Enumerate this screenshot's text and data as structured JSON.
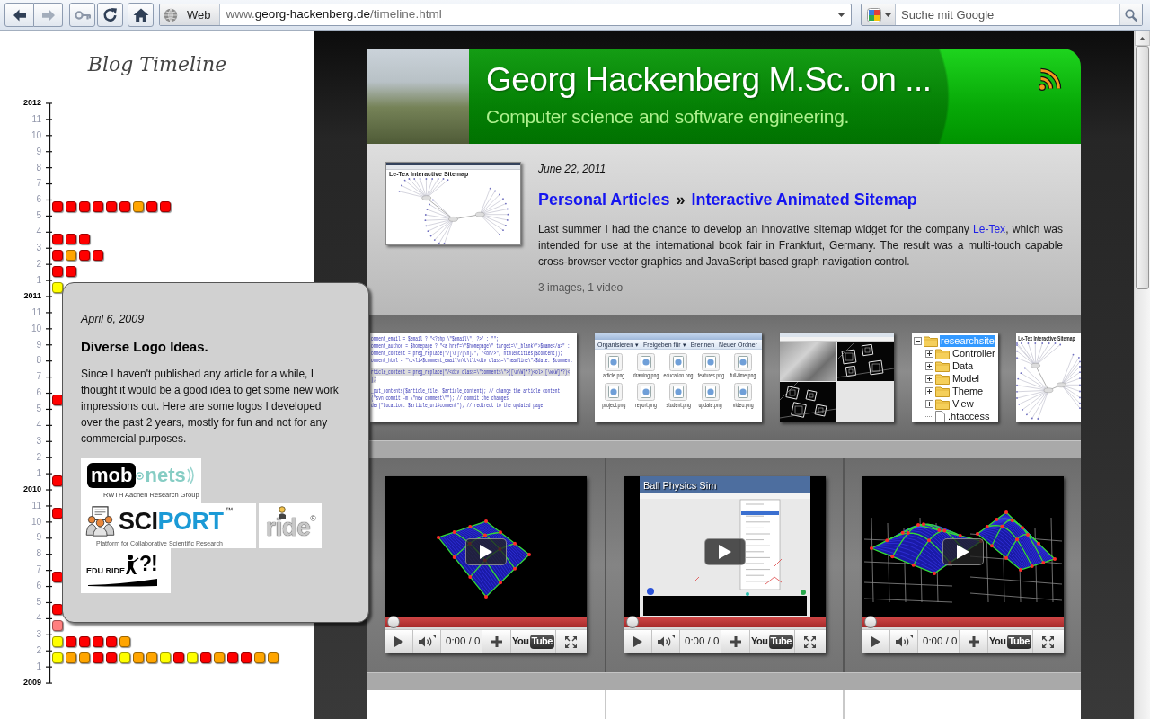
{
  "browser": {
    "back": {
      "disabled": false
    },
    "forward": {
      "disabled": true
    },
    "identity": "Web",
    "url": {
      "prefix": "www.",
      "domain": "georg-hackenberg.de",
      "path": "/timeline.html"
    },
    "search": {
      "placeholder": "Suche mit Google"
    }
  },
  "timeline": {
    "title": "Blog Timeline",
    "ticks": [
      {
        "label": "2012",
        "kind": "year"
      },
      {
        "label": "11",
        "kind": "month"
      },
      {
        "label": "10",
        "kind": "month"
      },
      {
        "label": "9",
        "kind": "month"
      },
      {
        "label": "8",
        "kind": "month"
      },
      {
        "label": "7",
        "kind": "month"
      },
      {
        "label": "6",
        "kind": "month",
        "posts": [
          {
            "color": "#ff0000"
          },
          {
            "color": "#ff0000"
          },
          {
            "color": "#ff0000"
          },
          {
            "color": "#ff0000"
          },
          {
            "color": "#ff0000"
          },
          {
            "color": "#ff0000"
          },
          {
            "color": "#ffa500"
          },
          {
            "color": "#ff0000"
          },
          {
            "color": "#ff0000"
          }
        ]
      },
      {
        "label": "5",
        "kind": "month"
      },
      {
        "label": "4",
        "kind": "month",
        "posts": [
          {
            "color": "#ff0000"
          },
          {
            "color": "#ff0000"
          },
          {
            "color": "#ff0000"
          }
        ]
      },
      {
        "label": "3",
        "kind": "month",
        "posts": [
          {
            "color": "#ff0000"
          },
          {
            "color": "#ffa500"
          },
          {
            "color": "#ff0000"
          },
          {
            "color": "#ff0000"
          }
        ]
      },
      {
        "label": "2",
        "kind": "month",
        "posts": [
          {
            "color": "#ff0000"
          },
          {
            "color": "#ff0000"
          }
        ]
      },
      {
        "label": "1",
        "kind": "month",
        "posts": [
          {
            "color": "#ffff00"
          }
        ]
      },
      {
        "label": "2011",
        "kind": "year"
      },
      {
        "label": "11",
        "kind": "month"
      },
      {
        "label": "10",
        "kind": "month"
      },
      {
        "label": "9",
        "kind": "month"
      },
      {
        "label": "8",
        "kind": "month"
      },
      {
        "label": "7",
        "kind": "month"
      },
      {
        "label": "6",
        "kind": "month",
        "posts": [
          {
            "color": "#ff0000"
          }
        ]
      },
      {
        "label": "5",
        "kind": "month"
      },
      {
        "label": "4",
        "kind": "month"
      },
      {
        "label": "3",
        "kind": "month"
      },
      {
        "label": "2",
        "kind": "month"
      },
      {
        "label": "1",
        "kind": "month",
        "posts": [
          {
            "color": "#ff0000"
          }
        ]
      },
      {
        "label": "2010",
        "kind": "year"
      },
      {
        "label": "11",
        "kind": "month",
        "posts": [
          {
            "color": "#ff0000"
          }
        ]
      },
      {
        "label": "10",
        "kind": "month"
      },
      {
        "label": "9",
        "kind": "month"
      },
      {
        "label": "8",
        "kind": "month"
      },
      {
        "label": "7",
        "kind": "month",
        "posts": [
          {
            "color": "#ff0000"
          }
        ]
      },
      {
        "label": "6",
        "kind": "month"
      },
      {
        "label": "5",
        "kind": "month",
        "posts": [
          {
            "color": "#ff0000"
          }
        ]
      },
      {
        "label": "4",
        "kind": "month",
        "posts": [
          {
            "color": "#ff8080"
          }
        ]
      },
      {
        "label": "3",
        "kind": "month",
        "posts": [
          {
            "color": "#ffff00"
          },
          {
            "color": "#ff0000"
          },
          {
            "color": "#ff0000"
          },
          {
            "color": "#ff0000"
          },
          {
            "color": "#ff0000"
          },
          {
            "color": "#ffa500"
          }
        ]
      },
      {
        "label": "2",
        "kind": "month",
        "posts": [
          {
            "color": "#ffff00"
          },
          {
            "color": "#ffa500"
          },
          {
            "color": "#ffa500"
          },
          {
            "color": "#ff0000"
          },
          {
            "color": "#ff0000"
          },
          {
            "color": "#ffff00"
          },
          {
            "color": "#ffa500"
          },
          {
            "color": "#ffa500"
          },
          {
            "color": "#ffff00"
          },
          {
            "color": "#ff0000"
          },
          {
            "color": "#ffff00"
          },
          {
            "color": "#ff0000"
          },
          {
            "color": "#ffa500"
          },
          {
            "color": "#ff0000"
          },
          {
            "color": "#ff0000"
          },
          {
            "color": "#ffa500"
          },
          {
            "color": "#ffa500"
          }
        ]
      },
      {
        "label": "1",
        "kind": "month"
      },
      {
        "label": "2009",
        "kind": "year"
      }
    ]
  },
  "popup": {
    "date": "April 6, 2009",
    "title": "Diverse Logo Ideas.",
    "text": "Since I haven't published any article for a while, I thought it would be a good idea to get some new work impressions out. Here are some logos I developed over the past 2 years, mostly for fun and not for any commercial purposes.",
    "logos": [
      {
        "kind": "mobonets",
        "words": [
          "mob",
          "nets"
        ],
        "tagline": "RWTH Aachen Research Group"
      },
      {
        "kind": "sciport",
        "words": [
          "SCI",
          "PORT"
        ],
        "mark": "™",
        "tagline": "Platform for Collaborative Scientific Research"
      },
      {
        "kind": "ride",
        "words": [
          "ride"
        ],
        "mark": "®"
      },
      {
        "kind": "eduride",
        "words": [
          "EDU RIDE",
          "?!"
        ]
      }
    ]
  },
  "header": {
    "title": "Georg Hackenberg M.Sc. on ...",
    "subtitle": "Computer science and software engineering."
  },
  "article": {
    "thumbnail_caption": "Le-Tex Interactive Sitemap",
    "date": "June 22, 2011",
    "category": "Personal Articles",
    "separator": "»",
    "title": "Interactive Animated Sitemap",
    "summary": {
      "before": "Last summer I had the chance to develop an innovative sitemap widget for the company ",
      "link": "Le-Tex",
      "after": ", which was intended for use at the international book fair in Frankfurt, Germany. The result was a multi-touch capable cross-browser vector graphics and JavaScript based graph navigation control."
    },
    "media_count": "3 images, 1 video"
  },
  "gallery": [
    {
      "kind": "code",
      "blocks": [
        {
          "lines": [
            {
              "text": "omment_email = $email ? \"<?php \\\"$email\\\"; ?>\" : \"\";",
              "highlighted": false
            },
            {
              "text": "omment_author = $homepage ? \"<a href=\\\"$homepage\\\" target=\\\"_blank\\\">$name</a>\" :",
              "highlighted": false
            },
            {
              "text": "omment_content = preg_replace(\"/[\\r]?[\\n]/\", \"<br/>\", htmlentities($content));",
              "highlighted": false
            },
            {
              "text": "omment_html = \"\\t<li>$comment_email\\n\\t\\t\\t<div class=\\\"headline\\\">$date: $comment",
              "highlighted": false
            }
          ]
        },
        {
          "lines": [
            {
              "text": "rticle_content = preg_replace(\"/<div class=\\\"comments\\\">([\\w\\W]*?)<ol>([\\w\\W]*?)<",
              "highlighted": true
            },
            {
              "text": ");",
              "highlighted": true
            }
          ]
        },
        {
          "lines": [
            {
              "text": "_put_contents($article_file, $article_content); // change the article content",
              "highlighted": false
            },
            {
              "text": "(\"svn commit -m \\\"new comment\\\"\"); // commit the changes",
              "highlighted": false
            },
            {
              "text": "der(\"Location: $article_uri#comment\"); // redirect to the updated page",
              "highlighted": false
            }
          ]
        }
      ]
    },
    {
      "kind": "explorer",
      "toolbar": [
        "Organisieren ▾",
        "Freigeben für ▾",
        "Brennen",
        "Neuer Ordner"
      ],
      "files": [
        "article.png",
        "drawing.png",
        "education.png",
        "features.png",
        "full-time.png",
        "project.png",
        "report.png",
        "student.png",
        "update.png",
        "video.png"
      ]
    },
    {
      "kind": "camera"
    },
    {
      "kind": "tree",
      "items": [
        {
          "label": "researchsite",
          "kind": "folder",
          "expanded": true,
          "selected": true,
          "children": [
            {
              "label": "Controller",
              "kind": "folder",
              "expanded": false,
              "selected": false
            },
            {
              "label": "Data",
              "kind": "folder",
              "expanded": false,
              "selected": false
            },
            {
              "label": "Model",
              "kind": "folder",
              "expanded": false,
              "selected": false
            },
            {
              "label": "Theme",
              "kind": "folder",
              "expanded": false,
              "selected": false
            },
            {
              "label": "View",
              "kind": "folder",
              "expanded": false,
              "selected": false
            },
            {
              "label": ".htaccess",
              "kind": "file",
              "selected": false
            }
          ]
        }
      ]
    },
    {
      "kind": "sitemap",
      "caption": "Le-Tex Interactive Sitemap"
    }
  ],
  "videos": [
    {
      "kind": "mesh",
      "level": 0,
      "time": "0:00 / 0",
      "logo": [
        "You",
        "Tube"
      ]
    },
    {
      "kind": "screen",
      "title": "Ball Physics Sim",
      "level": 0,
      "time": "0:00 / 0",
      "logo": [
        "You",
        "Tube"
      ]
    },
    {
      "kind": "wireframe",
      "level": 0,
      "time": "0:00 / 0",
      "logo": [
        "You",
        "Tube"
      ]
    }
  ]
}
